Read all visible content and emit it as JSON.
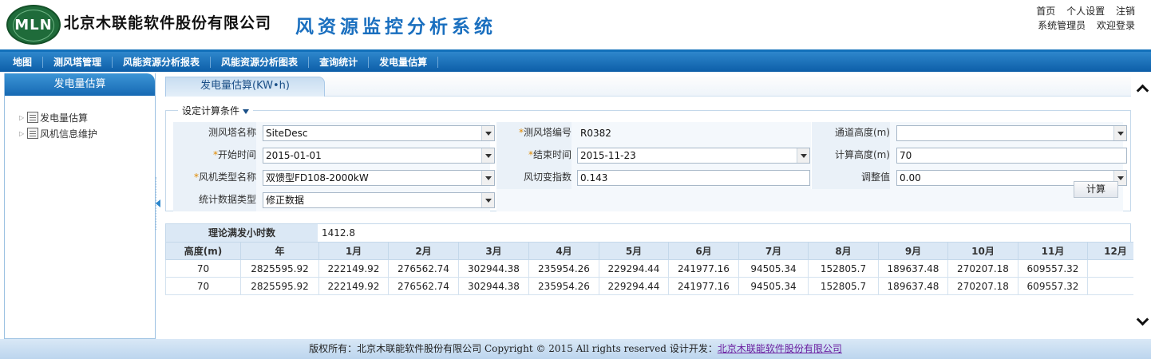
{
  "header": {
    "logo_text": "MLN",
    "company": "北京木联能软件股份有限公司",
    "system_title": "风资源监控分析系统",
    "links": [
      "首页",
      "个人设置",
      "注销"
    ],
    "user_role": "系统管理员",
    "welcome": "欢迎登录"
  },
  "nav": {
    "items": [
      "地图",
      "测风塔管理",
      "风能资源分析报表",
      "风能资源分析图表",
      "查询统计",
      "发电量估算"
    ]
  },
  "sidebar": {
    "title": "发电量估算",
    "items": [
      {
        "label": "发电量估算",
        "icon": "document-icon"
      },
      {
        "label": "风机信息维护",
        "icon": "document-icon"
      }
    ]
  },
  "main": {
    "tab_label": "发电量估算(KW•h)",
    "form": {
      "legend": "设定计算条件",
      "tower_name_label": "测风塔名称",
      "tower_name_value": "SiteDesc",
      "tower_code_label": "测风塔编号",
      "tower_code_value": "R0382",
      "channel_height_label": "通道高度(m)",
      "channel_height_value": "",
      "start_time_label": "开始时间",
      "start_time_value": "2015-01-01",
      "end_time_label": "结束时间",
      "end_time_value": "2015-11-23",
      "calc_height_label": "计算高度(m)",
      "calc_height_value": "70",
      "turbine_type_label": "风机类型名称",
      "turbine_type_value": "双馈型FD108-2000kW",
      "wind_shear_label": "风切变指数",
      "wind_shear_value": "0.143",
      "adjust_label": "调整值",
      "adjust_value": "0.00",
      "stat_type_label": "统计数据类型",
      "stat_type_value": "修正数据",
      "calc_button": "计算",
      "required_mark": "*"
    },
    "hours": {
      "label": "理论满发小时数",
      "value": "1412.8"
    },
    "table": {
      "headers": [
        "高度(m)",
        "年",
        "1月",
        "2月",
        "3月",
        "4月",
        "5月",
        "6月",
        "7月",
        "8月",
        "9月",
        "10月",
        "11月",
        "12月"
      ],
      "rows": [
        [
          "70",
          "2825595.92",
          "222149.92",
          "276562.74",
          "302944.38",
          "235954.26",
          "229294.44",
          "241977.16",
          "94505.34",
          "152805.7",
          "189637.48",
          "270207.18",
          "609557.32",
          ""
        ],
        [
          "70",
          "2825595.92",
          "222149.92",
          "276562.74",
          "302944.38",
          "235954.26",
          "229294.44",
          "241977.16",
          "94505.34",
          "152805.7",
          "189637.48",
          "270207.18",
          "609557.32",
          ""
        ]
      ]
    }
  },
  "footer": {
    "prefix": "版权所有：北京木联能软件股份有限公司",
    "copyright": "Copyright © 2015 All rights reserved",
    "dev_label": "设计开发：",
    "dev_link": "北京木联能软件股份有限公司"
  },
  "colors": {
    "nav_blue": "#0d5ea8",
    "title_blue": "#1a6fbf",
    "logo_green": "#1f6b3a",
    "required_orange": "#e08a00",
    "link_purple": "#6b1fa0"
  }
}
